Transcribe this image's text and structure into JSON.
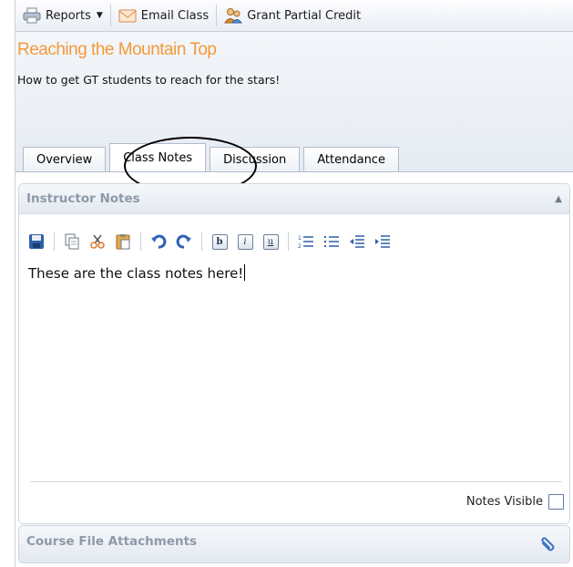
{
  "toolbar": {
    "reports_label": "Reports",
    "email_label": "Email Class",
    "grant_label": "Grant Partial Credit"
  },
  "course": {
    "title": "Reaching the Mountain Top",
    "description": "How to get GT students to reach for the stars!"
  },
  "tabs": [
    {
      "label": "Overview"
    },
    {
      "label": "Class Notes",
      "active": true
    },
    {
      "label": "Discussion"
    },
    {
      "label": "Attendance"
    }
  ],
  "notes_panel": {
    "title": "Instructor Notes",
    "content": "These are the class notes here!",
    "visible_label": "Notes Visible",
    "visible_checked": false
  },
  "editor_buttons": [
    "save-icon",
    "copy-icon",
    "cut-icon",
    "paste-icon",
    "undo-icon",
    "redo-icon",
    "bold-icon",
    "italic-icon",
    "underline-icon",
    "numbered-list-icon",
    "bullet-list-icon",
    "outdent-icon",
    "indent-icon"
  ],
  "format_letters": {
    "bold": "b",
    "italic": "i",
    "underline": "u"
  },
  "attachments_panel": {
    "title": "Course File Attachments"
  },
  "colors": {
    "accent_title": "#f39a3a",
    "panel_title": "#8e9aa8"
  }
}
